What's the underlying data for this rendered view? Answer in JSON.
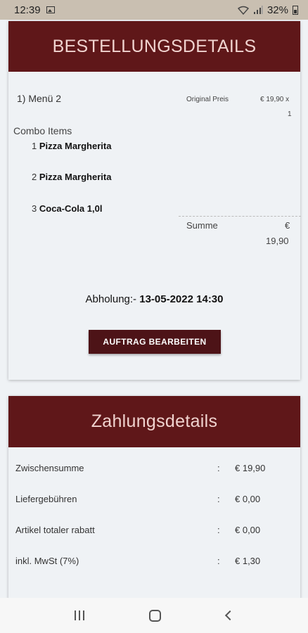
{
  "status_bar": {
    "time": "12:39",
    "battery": "32%"
  },
  "order_details": {
    "title": "BESTELLUNGSDETAILS",
    "menu_name": "1) Menü 2",
    "original_price_label": "Original Preis",
    "original_price": "€ 19,90 x",
    "quantity": "1",
    "combo_label": "Combo Items",
    "combo_items": [
      {
        "index": "1",
        "name": "Pizza Margherita"
      },
      {
        "index": "2",
        "name": "Pizza Margherita"
      },
      {
        "index": "3",
        "name": "Coca-Cola 1,0l"
      }
    ],
    "sum_label": "Summe",
    "sum_currency": "€",
    "sum_value": "19,90",
    "pickup_label": "Abholung:-",
    "pickup_datetime": "13-05-2022 14:30",
    "edit_button": "AUFTRAG BEARBEITEN"
  },
  "payment_details": {
    "title": "Zahlungsdetails",
    "separator": ":",
    "rows": [
      {
        "label": "Zwischensumme",
        "value": "€ 19,90"
      },
      {
        "label": "Liefergebühren",
        "value": "€ 0,00"
      },
      {
        "label": "Artikel totaler rabatt",
        "value": "€ 0,00"
      },
      {
        "label": "inkl. MwSt (7%)",
        "value": "€ 1,30"
      }
    ]
  },
  "icons": [
    "image-icon",
    "wifi-icon",
    "signal-icon",
    "battery-icon",
    "recent-apps-icon",
    "home-icon",
    "back-icon"
  ]
}
